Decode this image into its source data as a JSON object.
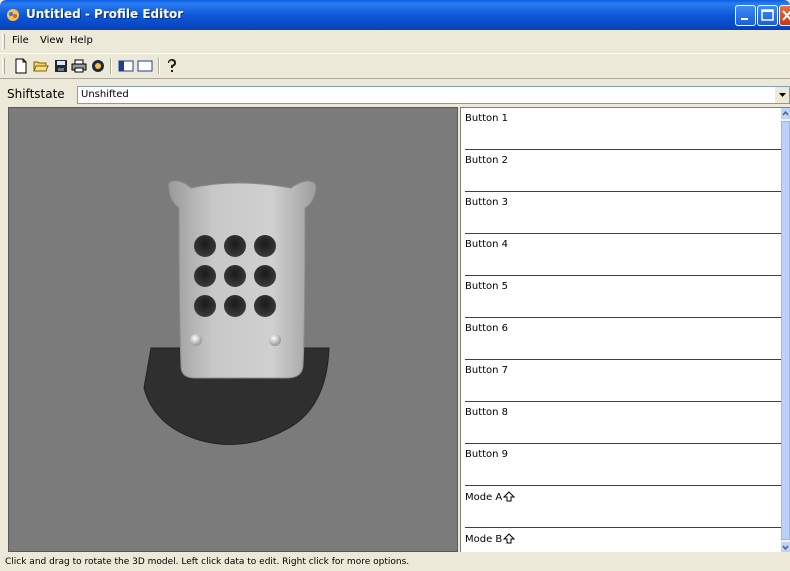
{
  "window": {
    "title": "Untitled - Profile Editor",
    "title_bar_color": "#0a58dc"
  },
  "menu": {
    "items": [
      "File",
      "View",
      "Help"
    ]
  },
  "toolbar": {
    "icons": [
      "new-document-icon",
      "open-folder-icon",
      "save-icon",
      "print-icon",
      "settings-icon",
      "split-view-icon",
      "single-view-icon",
      "help-icon"
    ]
  },
  "shiftstate": {
    "label": "Shiftstate",
    "value": "Unshifted"
  },
  "viewport": {
    "background_color": "#7b7b7b",
    "model_keypad_rows": 3,
    "model_keypad_cols": 3
  },
  "buttons_panel": {
    "entries": [
      {
        "label": "Button 1"
      },
      {
        "label": "Button 2"
      },
      {
        "label": "Button 3"
      },
      {
        "label": "Button 4"
      },
      {
        "label": "Button 5"
      },
      {
        "label": "Button 6"
      },
      {
        "label": "Button 7"
      },
      {
        "label": "Button 8"
      },
      {
        "label": "Button 9"
      },
      {
        "label": "Mode A"
      },
      {
        "label": "Mode B"
      }
    ]
  },
  "status": {
    "text": "Click and drag to rotate the 3D model. Left click data to edit. Right click for more options."
  }
}
